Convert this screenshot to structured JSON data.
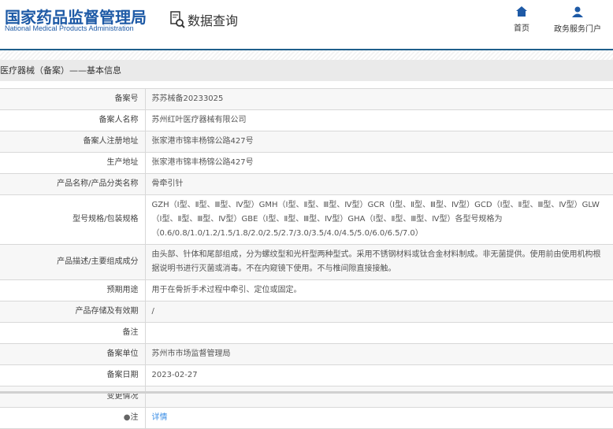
{
  "header": {
    "logo_cn": "国家药品监督管理局",
    "logo_en": "National Medical Products Administration",
    "query_label": "数据查询",
    "nav": [
      {
        "label": "首页",
        "icon": "home-icon"
      },
      {
        "label": "政务服务门户",
        "icon": "user-icon"
      }
    ]
  },
  "breadcrumb": "医疗器械（备案）——基本信息",
  "rows": [
    {
      "label": "备案号",
      "value": "苏苏械备20233025"
    },
    {
      "label": "备案人名称",
      "value": "苏州红叶医疗器械有限公司"
    },
    {
      "label": "备案人注册地址",
      "value": "张家港市锦丰杨锦公路427号"
    },
    {
      "label": "生产地址",
      "value": "张家港市锦丰杨锦公路427号"
    },
    {
      "label": "产品名称/产品分类名称",
      "value": "骨牵引针"
    },
    {
      "label": "型号规格/包装规格",
      "value": "GZH（Ⅰ型、Ⅱ型、Ⅲ型、Ⅳ型）GMH（Ⅰ型、Ⅱ型、Ⅲ型、Ⅳ型）GCR（Ⅰ型、Ⅱ型、Ⅲ型、Ⅳ型）GCD（Ⅰ型、Ⅱ型、Ⅲ型、Ⅳ型）GLW（Ⅰ型、Ⅱ型、Ⅲ型、Ⅳ型）GBE（Ⅰ型、Ⅱ型、Ⅲ型、Ⅳ型）GHA（Ⅰ型、Ⅱ型、Ⅲ型、Ⅳ型）各型号规格为（0.6/0.8/1.0/1.2/1.5/1.8/2.0/2.5/2.7/3.0/3.5/4.0/4.5/5.0/6.0/6.5/7.0）"
    },
    {
      "label": "产品描述/主要组成成分",
      "value": "由头部、针体和尾部组成，分为螺纹型和光杆型两种型式。采用不锈钢材料或钛合金材料制成。非无菌提供。使用前由使用机构根据说明书进行灭菌或消毒。不在内窥镜下使用。不与椎间隙直接接触。"
    },
    {
      "label": "预期用途",
      "value": "用于在骨折手术过程中牵引、定位或固定。"
    },
    {
      "label": "产品存储及有效期",
      "value": "/"
    },
    {
      "label": "备注",
      "value": ""
    },
    {
      "label": "备案单位",
      "value": "苏州市市场监督管理局"
    },
    {
      "label": "备案日期",
      "value": "2023-02-27"
    },
    {
      "label": "变更情况",
      "value": ""
    }
  ],
  "note": {
    "label": "注",
    "link": "详情"
  }
}
